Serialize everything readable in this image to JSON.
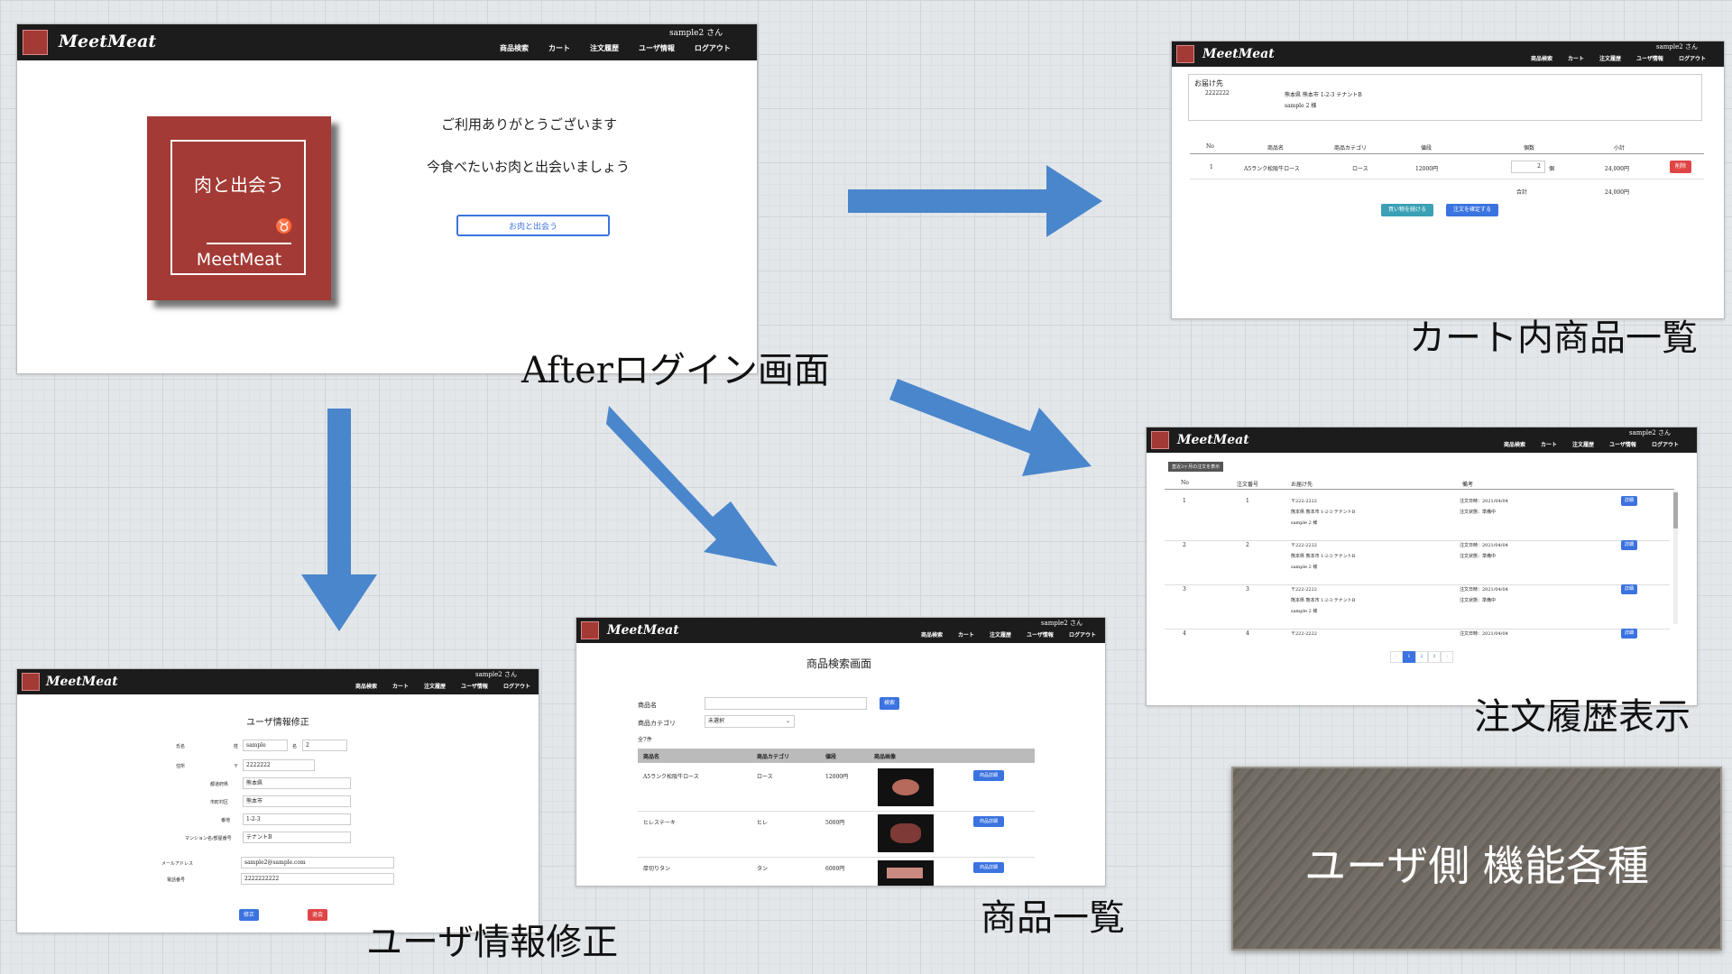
{
  "nav": {
    "brand": "MeetMeat",
    "user": "sample2 さん",
    "menu": [
      "商品検索",
      "カート",
      "注文履歴",
      "ユーザ情報",
      "ログアウト"
    ]
  },
  "captions": {
    "after_login": "Afterログイン画面",
    "cart": "カート内商品一覧",
    "history": "注文履歴表示",
    "products": "商品一覧",
    "user_edit": "ユーザ情報修正",
    "panel": "ユーザ側 機能各種"
  },
  "colors": {
    "accent_red": "#a33a35",
    "nav": "#1c1c1c",
    "arrow": "#4a86cc",
    "button_blue": "#3b73e0"
  },
  "after_login": {
    "welcome": "ご利用ありがとうございます",
    "tagline": "今食べたいお肉と出会いましょう",
    "button": "お肉と出会う",
    "logo_text": "肉と出会う",
    "logo_brand": "MeetMeat"
  },
  "cart": {
    "address_label": "お届け先",
    "zip": "2222222",
    "address": "熊本県 熊本市 1-2-3 テナントB",
    "name": "sample 2 様",
    "headers": [
      "No",
      "商品名",
      "商品カテゴリ",
      "値段",
      "個数",
      "小計"
    ],
    "row": {
      "no": "1",
      "name": "A5ランク松阪牛ロース",
      "category": "ロース",
      "price": "12000円",
      "qty": "2",
      "unit": "個",
      "subtotal": "24,000円",
      "delete": "削除"
    },
    "total_label": "合計",
    "total": "24,000円",
    "continue": "買い物を続ける",
    "confirm": "注文を確定する"
  },
  "history": {
    "filter": "直近3ヶ月の注文を表示",
    "headers": [
      "No",
      "注文番号",
      "お届け先",
      "備考"
    ],
    "rows": [
      {
        "no": "1",
        "order": "1",
        "zip": "〒222-2222",
        "addr": "熊本県 熊本市 1-2-3 テナントB",
        "name": "sample 2 様",
        "date": "注文日時：2021/04/04",
        "status": "注文状態：準備中",
        "btn": "詳細"
      },
      {
        "no": "2",
        "order": "2",
        "zip": "〒222-2222",
        "addr": "熊本県 熊本市 1-2-3 テナントB",
        "name": "sample 2 様",
        "date": "注文日時：2021/04/04",
        "status": "注文状態：準備中",
        "btn": "詳細"
      },
      {
        "no": "3",
        "order": "3",
        "zip": "〒222-2222",
        "addr": "熊本県 熊本市 1-2-3 テナントB",
        "name": "sample 2 様",
        "date": "注文日時：2021/04/04",
        "status": "注文状態：準備中",
        "btn": "詳細"
      },
      {
        "no": "4",
        "order": "4",
        "zip": "〒222-2222",
        "addr": "",
        "name": "",
        "date": "注文日時：2021/04/04",
        "status": "",
        "btn": "詳細"
      }
    ],
    "pages": [
      "‹",
      "1",
      "2",
      "3",
      "›"
    ]
  },
  "products": {
    "title": "商品検索画面",
    "name_label": "商品名",
    "search_btn": "検索",
    "category_label": "商品カテゴリ",
    "category_value": "未選択",
    "count": "全7件",
    "headers": [
      "商品名",
      "商品カテゴリ",
      "値段",
      "商品画像"
    ],
    "rows": [
      {
        "name": "A5ランク松阪牛ロース",
        "category": "ロース",
        "price": "12000円",
        "btn": "商品詳細"
      },
      {
        "name": "ヒレステーキ",
        "category": "ヒレ",
        "price": "5000円",
        "btn": "商品詳細"
      },
      {
        "name": "厚切りタン",
        "category": "タン",
        "price": "6000円",
        "btn": "商品詳細"
      }
    ]
  },
  "user_edit": {
    "title": "ユーザ情報修正",
    "name_label": "氏名",
    "sei_label": "姓",
    "sei": "sample",
    "mei_label": "名",
    "mei": "2",
    "addr_label": "住所",
    "zip_label": "〒",
    "zip": "2222222",
    "pref_label": "都道府県",
    "pref": "熊本県",
    "city_label": "市町村区",
    "city": "熊本市",
    "street_label": "番地",
    "street": "1-2-3",
    "bldg_label": "マンション名/部屋番号",
    "bldg": "テナントB",
    "mail_label": "メールアドレス",
    "mail": "sample2@sample.com",
    "tel_label": "電話番号",
    "tel": "2222222222",
    "edit_btn": "修正",
    "leave_btn": "退会"
  }
}
